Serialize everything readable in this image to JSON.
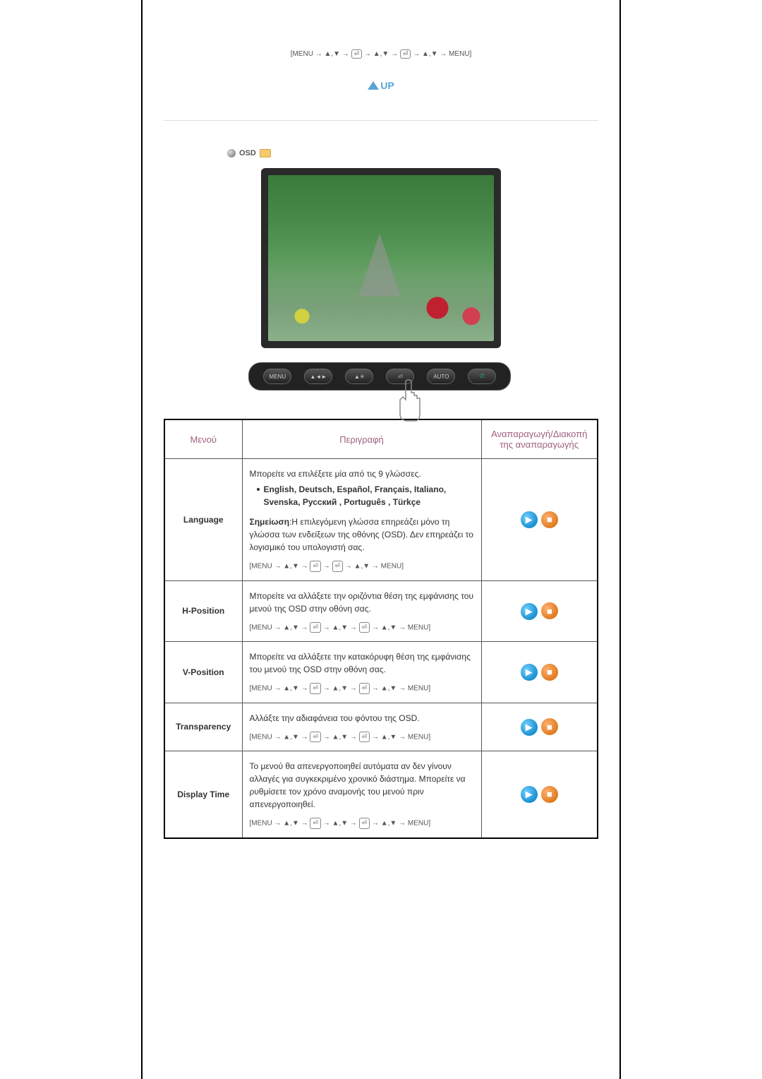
{
  "top_nav": {
    "prefix": "[MENU → ",
    "arrows1": "▲,▼ → ",
    "enter1": "⏎",
    "mid": " → ▲,▼ → ",
    "enter2": "⏎",
    "suffix": " → ▲,▼ → MENU]"
  },
  "up_button": {
    "label": "UP"
  },
  "osd": {
    "label": "OSD"
  },
  "button_bar": {
    "btn1": "MENU",
    "btn2": "▲◄►",
    "btn3": "▲✳",
    "btn4": "⏎",
    "btn5": "AUTO",
    "btn6": "⏻"
  },
  "table": {
    "headers": {
      "menu": "Μενού",
      "desc": "Περιγραφή",
      "play": "Αναπαραγωγή/Διακοπή της αναπαραγωγής"
    },
    "rows": [
      {
        "name": "Language",
        "desc_line1": "Μπορείτε να επιλέξετε μία από τις 9 γλώσσες.",
        "bullet": "English, Deutsch, Español, Français,  Italiano, Svenska, Русский , Português , Türkçe",
        "note_label": "Σημείωση",
        "note_text": ":Η επιλεγόμενη γλώσσα επηρεάζει μόνο τη γλώσσα των ενδείξεων της οθόνης (OSD). Δεν επηρεάζει το λογισμικό του υπολογιστή σας.",
        "nav_prefix": "[MENU → ▲,▼ → ",
        "nav_e1": "⏎",
        "nav_mid1": " → ",
        "nav_e2": "⏎",
        "nav_suffix": " → ▲,▼ → MENU]"
      },
      {
        "name": "H-Position",
        "desc_line1": "Μπορείτε να αλλάξετε την οριζόντια θέση της εμφάνισης του μενού της OSD στην οθόνη σας.",
        "nav_prefix": "[MENU → ▲,▼ → ",
        "nav_e1": "⏎",
        "nav_mid1": " → ▲,▼ → ",
        "nav_e2": "⏎",
        "nav_suffix": " → ▲,▼ → MENU]"
      },
      {
        "name": "V-Position",
        "desc_line1": "Μπορείτε να αλλάξετε την κατακόρυφη θέση της εμφάνισης του μενού της OSD στην οθόνη σας.",
        "nav_prefix": "[MENU → ▲,▼ → ",
        "nav_e1": "⏎",
        "nav_mid1": " → ▲,▼ → ",
        "nav_e2": "⏎",
        "nav_suffix": " → ▲,▼ → MENU]"
      },
      {
        "name": "Transparency",
        "desc_line1": "Αλλάξτε την αδιαφάνεια του φόντου της OSD.",
        "nav_prefix": "[MENU → ▲,▼ → ",
        "nav_e1": "⏎",
        "nav_mid1": " → ▲,▼ → ",
        "nav_e2": "⏎",
        "nav_suffix": " → ▲,▼ → MENU]"
      },
      {
        "name": "Display Time",
        "desc_line1": "Το μενού θα απενεργοποιηθεί αυτόματα αν δεν γίνουν αλλαγές για συγκεκριμένο χρονικό διάστημα. Μπορείτε να ρυθμίσετε τον χρόνο αναμονής του μενού πριν απενεργοποιηθεί.",
        "nav_prefix": "[MENU → ▲,▼ → ",
        "nav_e1": "⏎",
        "nav_mid1": " → ▲,▼ → ",
        "nav_e2": "⏎",
        "nav_suffix": " → ▲,▼ → MENU]"
      }
    ]
  }
}
